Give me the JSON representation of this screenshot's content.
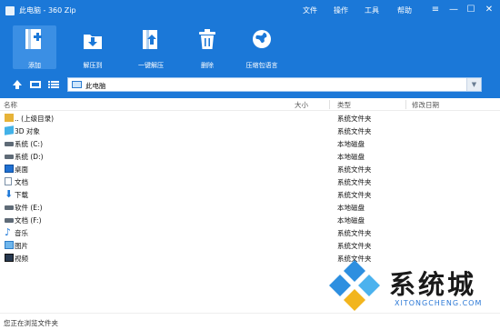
{
  "window": {
    "title": "此电脑 - 360 Zip",
    "menus": [
      "文件",
      "操作",
      "工具",
      "帮助"
    ],
    "controls": {
      "menu": "≡",
      "minimize": "—",
      "maximize": "☐",
      "close": "✕"
    }
  },
  "toolbar": {
    "buttons": [
      {
        "label": "添加",
        "icon": "add-icon",
        "active": true
      },
      {
        "label": "解压到",
        "icon": "extract-to-icon",
        "active": false
      },
      {
        "label": "一键解压",
        "icon": "one-click-extract-icon",
        "active": false
      },
      {
        "label": "删除",
        "icon": "trash-icon",
        "active": false
      },
      {
        "label": "压缩包语言",
        "icon": "globe-icon",
        "active": false
      }
    ]
  },
  "address": {
    "path": "此电脑",
    "dropdown": "▼"
  },
  "columns": [
    "名称",
    "大小",
    "类型",
    "修改日期"
  ],
  "files": [
    {
      "name": ".. (上级目录)",
      "type": "系统文件夹",
      "icon": "up-folder-icon"
    },
    {
      "name": "3D 对象",
      "type": "系统文件夹",
      "icon": "3d-objects-icon"
    },
    {
      "name": "系统 (C:)",
      "type": "本地磁盘",
      "icon": "drive-icon"
    },
    {
      "name": "系统 (D:)",
      "type": "本地磁盘",
      "icon": "drive-icon"
    },
    {
      "name": "桌面",
      "type": "系统文件夹",
      "icon": "desktop-icon"
    },
    {
      "name": "文档",
      "type": "系统文件夹",
      "icon": "document-icon"
    },
    {
      "name": "下载",
      "type": "系统文件夹",
      "icon": "download-icon"
    },
    {
      "name": "软件 (E:)",
      "type": "本地磁盘",
      "icon": "drive-icon"
    },
    {
      "name": "文档 (F:)",
      "type": "本地磁盘",
      "icon": "drive-icon"
    },
    {
      "name": "音乐",
      "type": "系统文件夹",
      "icon": "music-icon"
    },
    {
      "name": "图片",
      "type": "系统文件夹",
      "icon": "pictures-icon"
    },
    {
      "name": "视频",
      "type": "系统文件夹",
      "icon": "video-icon"
    }
  ],
  "status": "您正在浏览文件夹",
  "watermark": {
    "text": "系统城",
    "sub": "XITONGCHENG.COM"
  },
  "colors": {
    "chrome": "#1b78d8",
    "accent": "#3b8fe4"
  }
}
